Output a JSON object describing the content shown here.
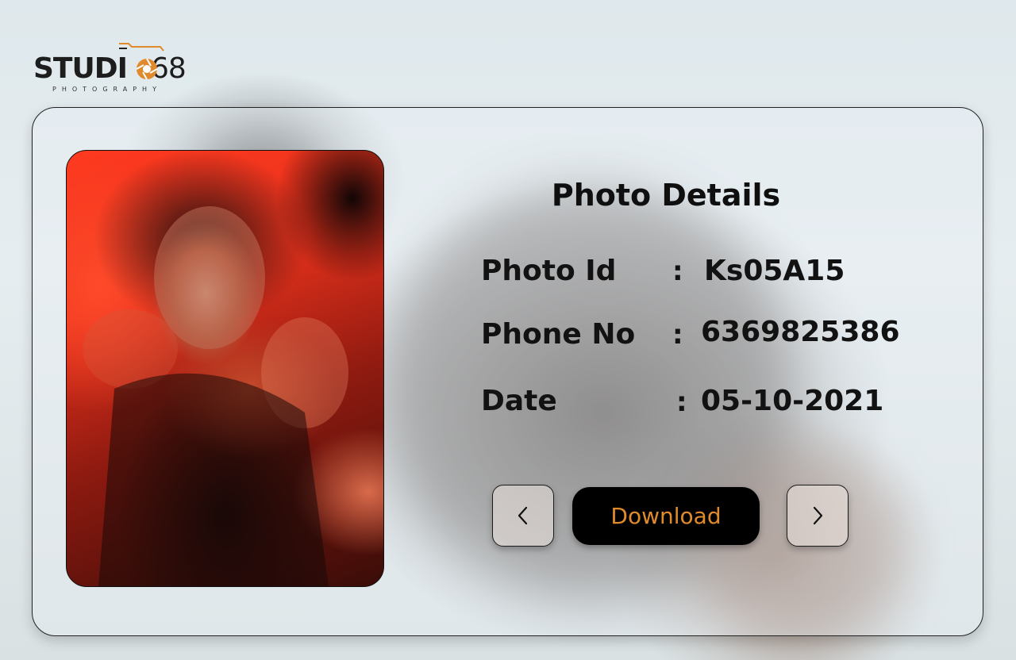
{
  "brand": {
    "name_text": "STUDI",
    "name_number": "68",
    "tagline": "PHOTOGRAPHY",
    "accent_color": "#e08a2e"
  },
  "card": {
    "title": "Photo Details",
    "photo_alt": "Portrait photo",
    "fields": [
      {
        "label": "Photo Id",
        "colon": ":",
        "value": "Ks05A15"
      },
      {
        "label": "Phone No",
        "colon": ":",
        "value": "6369825386"
      },
      {
        "label": "Date",
        "colon": ":",
        "value": "05-10-2021"
      }
    ],
    "actions": {
      "download_label": "Download",
      "prev_icon": "chevron-left-icon",
      "next_icon": "chevron-right-icon"
    }
  }
}
